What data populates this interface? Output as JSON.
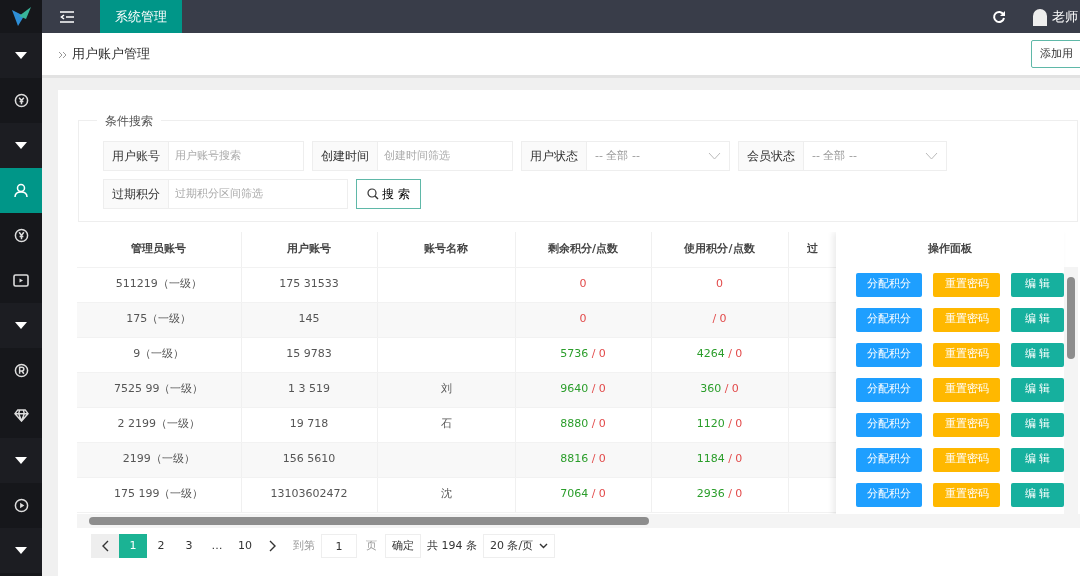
{
  "topbar": {
    "tab": "系统管理",
    "user": "老师"
  },
  "sidebar": {
    "items": [
      {
        "kind": "caret",
        "selected": false
      },
      {
        "kind": "yen-cycle",
        "selected": false
      },
      {
        "kind": "caret",
        "selected": false
      },
      {
        "kind": "user",
        "selected": true
      },
      {
        "kind": "yen",
        "selected": false
      },
      {
        "kind": "video",
        "selected": false
      },
      {
        "kind": "caret",
        "selected": false
      },
      {
        "kind": "registered",
        "selected": false
      },
      {
        "kind": "diamond",
        "selected": false
      },
      {
        "kind": "caret",
        "selected": false
      },
      {
        "kind": "play",
        "selected": false
      },
      {
        "kind": "caret",
        "selected": false
      }
    ]
  },
  "breadcrumb": "用户账户管理",
  "add_button": "添加用",
  "search": {
    "legend": "条件搜索",
    "fields": [
      {
        "kind": "text",
        "label": "用户账号",
        "placeholder": "用户账号搜索"
      },
      {
        "kind": "text",
        "label": "创建时间",
        "placeholder": "创建时间筛选"
      },
      {
        "kind": "select",
        "label": "用户状态",
        "value": "-- 全部 --"
      },
      {
        "kind": "select",
        "label": "会员状态",
        "value": "-- 全部 --"
      },
      {
        "kind": "text",
        "label": "过期积分",
        "placeholder": "过期积分区间筛选"
      }
    ],
    "button": "搜 索"
  },
  "table": {
    "columns": [
      "管理员账号",
      "用户账号",
      "账号名称",
      "剩余积分/点数",
      "使用积分/点数",
      "过"
    ],
    "actions_title": "操作面板",
    "rows": [
      {
        "admin": "511219（一级）",
        "user": "175 31533",
        "name": "",
        "remaining": "",
        "remaining_extra": "0",
        "used": "",
        "used_extra": "0",
        "actions": [
          "分配积分",
          "重置密码",
          "编 辑"
        ]
      },
      {
        "admin": "175（一级）",
        "user": "145",
        "name": "",
        "remaining": "",
        "remaining_extra": "0",
        "used": "",
        "used_extra": "/ 0",
        "actions": [
          "分配积分",
          "重置密码",
          "编 辑"
        ]
      },
      {
        "admin": "9（一级）",
        "user": "15 9783",
        "name": "",
        "remaining": "5736",
        "remaining_extra": "/ 0",
        "used": "4264",
        "used_extra": "/ 0",
        "actions": [
          "分配积分",
          "重置密码",
          "编 辑"
        ]
      },
      {
        "admin": "7525 99（一级）",
        "user": "1 3 519",
        "name": "刘",
        "remaining": "9640",
        "remaining_extra": "/ 0",
        "used": "360",
        "used_extra": "/ 0",
        "actions": [
          "分配积分",
          "重置密码",
          "编 辑"
        ]
      },
      {
        "admin": "2 2199（一级）",
        "user": "19 718",
        "name": "石",
        "remaining": "8880",
        "remaining_extra": "/ 0",
        "used": "1120",
        "used_extra": "/ 0",
        "actions": [
          "分配积分",
          "重置密码",
          "编 辑"
        ]
      },
      {
        "admin": "2199（一级）",
        "user": "156 5610",
        "name": "",
        "remaining": "8816",
        "remaining_extra": "/ 0",
        "used": "1184",
        "used_extra": "/ 0",
        "actions": [
          "分配积分",
          "重置密码",
          "编 辑"
        ]
      },
      {
        "admin": "175 199（一级）",
        "user": "13103602472",
        "name": "沈",
        "remaining": "7064",
        "remaining_extra": "/ 0",
        "used": "2936",
        "used_extra": "/ 0",
        "actions": [
          "分配积分",
          "重置密码",
          "编 辑"
        ]
      }
    ]
  },
  "pagination": {
    "pages": [
      {
        "label": "1",
        "selected": true
      },
      {
        "label": "2",
        "selected": false
      },
      {
        "label": "3",
        "selected": false
      },
      {
        "label": "…",
        "selected": false
      },
      {
        "label": "10",
        "selected": false
      }
    ],
    "goto_label": "到第",
    "goto_value": "1",
    "page_unit": "页",
    "confirm": "确定",
    "total": "共 194 条",
    "page_size": "20 条/页"
  }
}
